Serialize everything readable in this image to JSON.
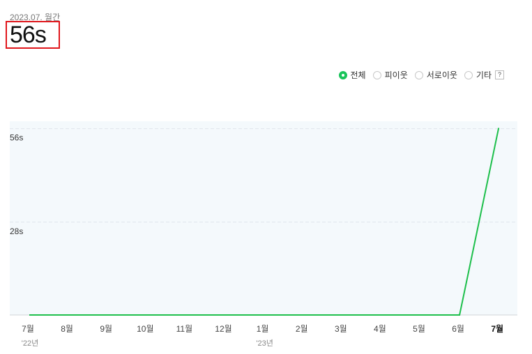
{
  "header": {
    "period": "2023.07. 월간",
    "value": "56s"
  },
  "filters": [
    {
      "label": "전체",
      "checked": true
    },
    {
      "label": "피이웃",
      "checked": false
    },
    {
      "label": "서로이웃",
      "checked": false
    },
    {
      "label": "기타",
      "checked": false
    }
  ],
  "help_label": "?",
  "colors": {
    "line": "#1dbf4b",
    "plot_bg": "#f4f9fc",
    "highlight_border": "#e0161b"
  },
  "chart_data": {
    "type": "line",
    "categories": [
      "7월",
      "8월",
      "9월",
      "10월",
      "11월",
      "12월",
      "1월",
      "2월",
      "3월",
      "4월",
      "5월",
      "6월",
      "7월"
    ],
    "year_labels": [
      {
        "index": 0,
        "label": "'22년"
      },
      {
        "index": 6,
        "label": "'23년"
      }
    ],
    "series": [
      {
        "values": [
          0,
          0,
          0,
          0,
          0,
          0,
          0,
          0,
          0,
          0,
          0,
          0,
          56
        ]
      }
    ],
    "y_ticks": [
      {
        "value": 28,
        "label": "28s"
      },
      {
        "value": 56,
        "label": "56s"
      }
    ],
    "ylim": [
      0,
      58
    ],
    "current_index": 12
  }
}
